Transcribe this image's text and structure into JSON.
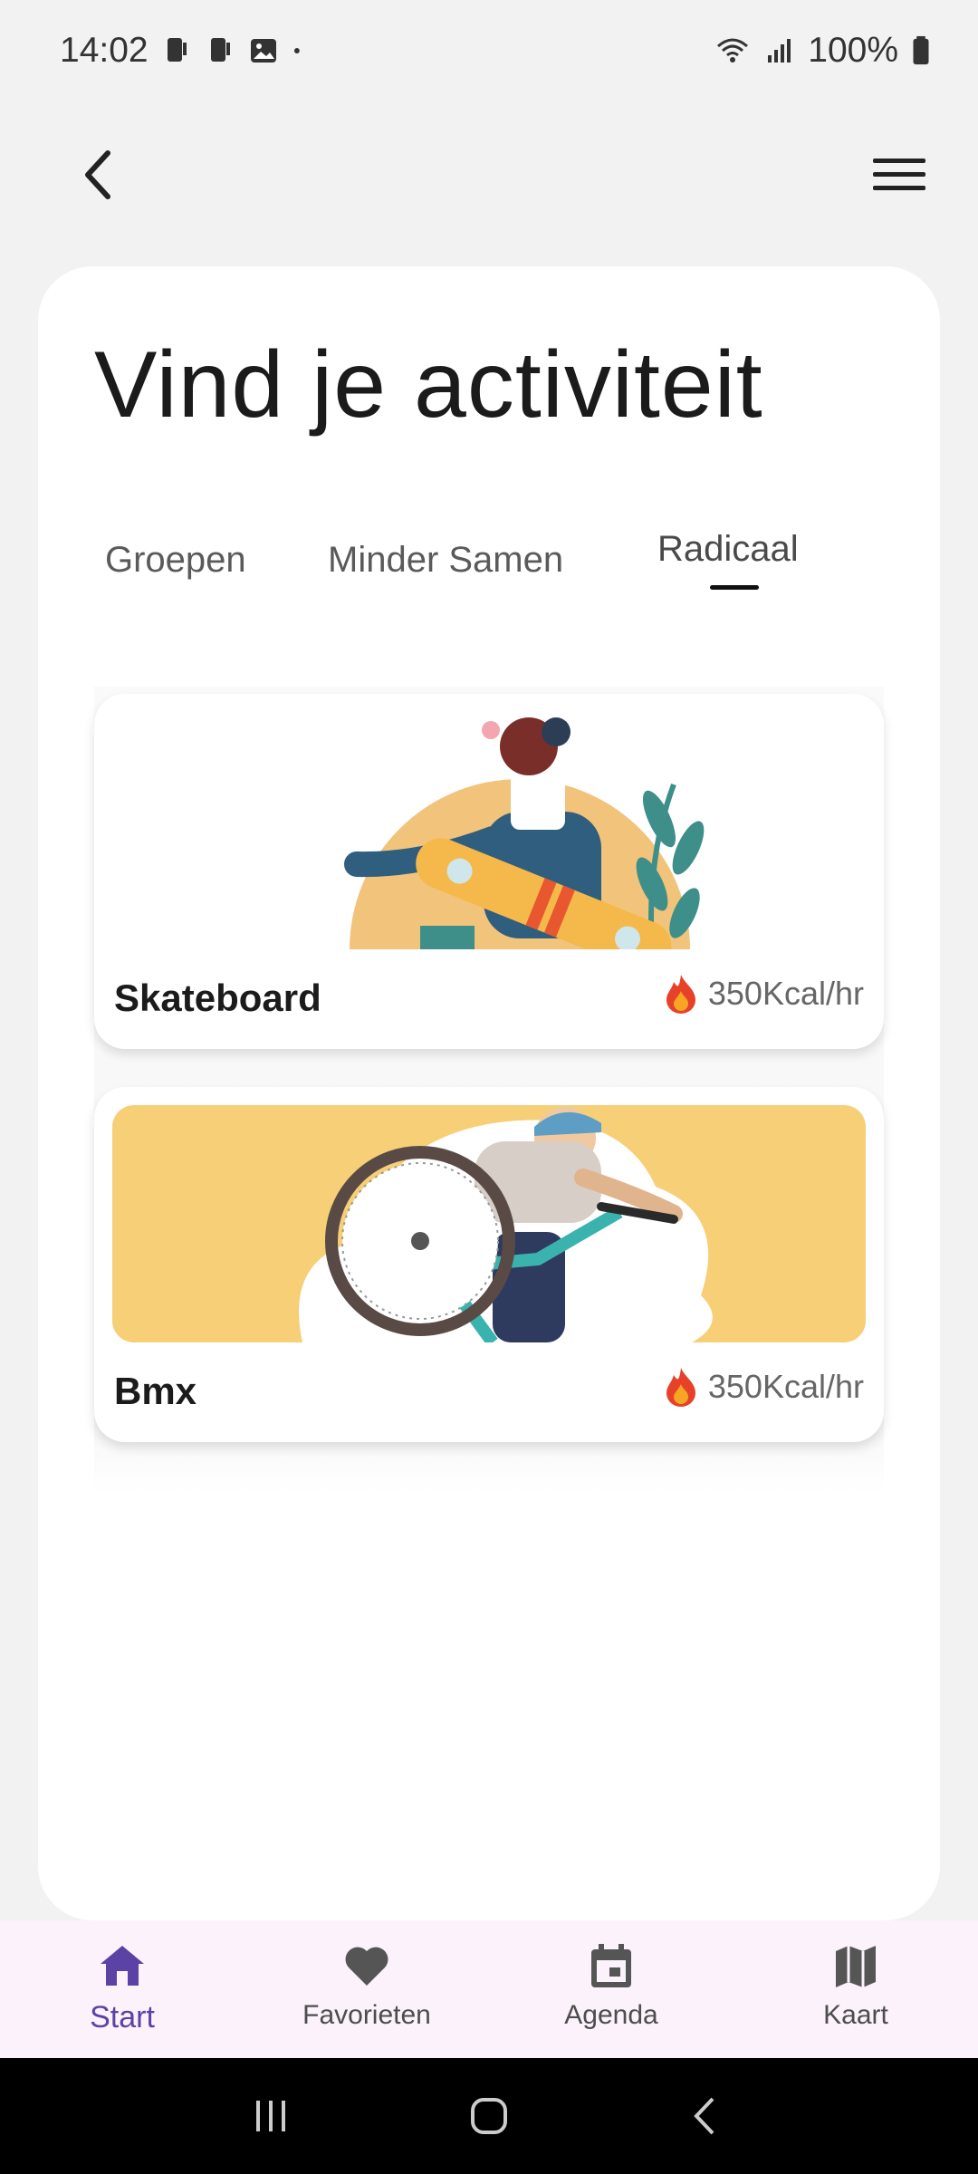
{
  "status_bar": {
    "time": "14:02",
    "battery": "100%",
    "icons": [
      "phone-icon",
      "phone-icon",
      "image-icon",
      "dot-icon",
      "wifi-icon",
      "signal-icon",
      "battery-icon"
    ]
  },
  "top_bar": {
    "back_icon": "chevron-left-icon",
    "menu_icon": "hamburger-menu-icon"
  },
  "page": {
    "title": "Vind je activiteit"
  },
  "tabs": [
    {
      "label": "Groepen",
      "active": false
    },
    {
      "label": "Minder Samen",
      "active": false
    },
    {
      "label": "Radicaal",
      "active": true
    }
  ],
  "activities": [
    {
      "name": "Skateboard",
      "kcal": "350Kcal/hr",
      "icon": "fire-icon"
    },
    {
      "name": "Bmx",
      "kcal": "350Kcal/hr",
      "icon": "fire-icon"
    }
  ],
  "bottom_nav": [
    {
      "label": "Start",
      "icon": "home-icon",
      "active": true
    },
    {
      "label": "Favorieten",
      "icon": "heart-icon",
      "active": false
    },
    {
      "label": "Agenda",
      "icon": "calendar-icon",
      "active": false
    },
    {
      "label": "Kaart",
      "icon": "map-icon",
      "active": false
    }
  ],
  "colors": {
    "accent": "#5b43a6",
    "background": "#f2f2f2",
    "card": "#ffffff",
    "nav_background": "#fbf2fb",
    "illustration_orange": "#f2c37a",
    "illustration_yellow": "#f6cf76"
  }
}
